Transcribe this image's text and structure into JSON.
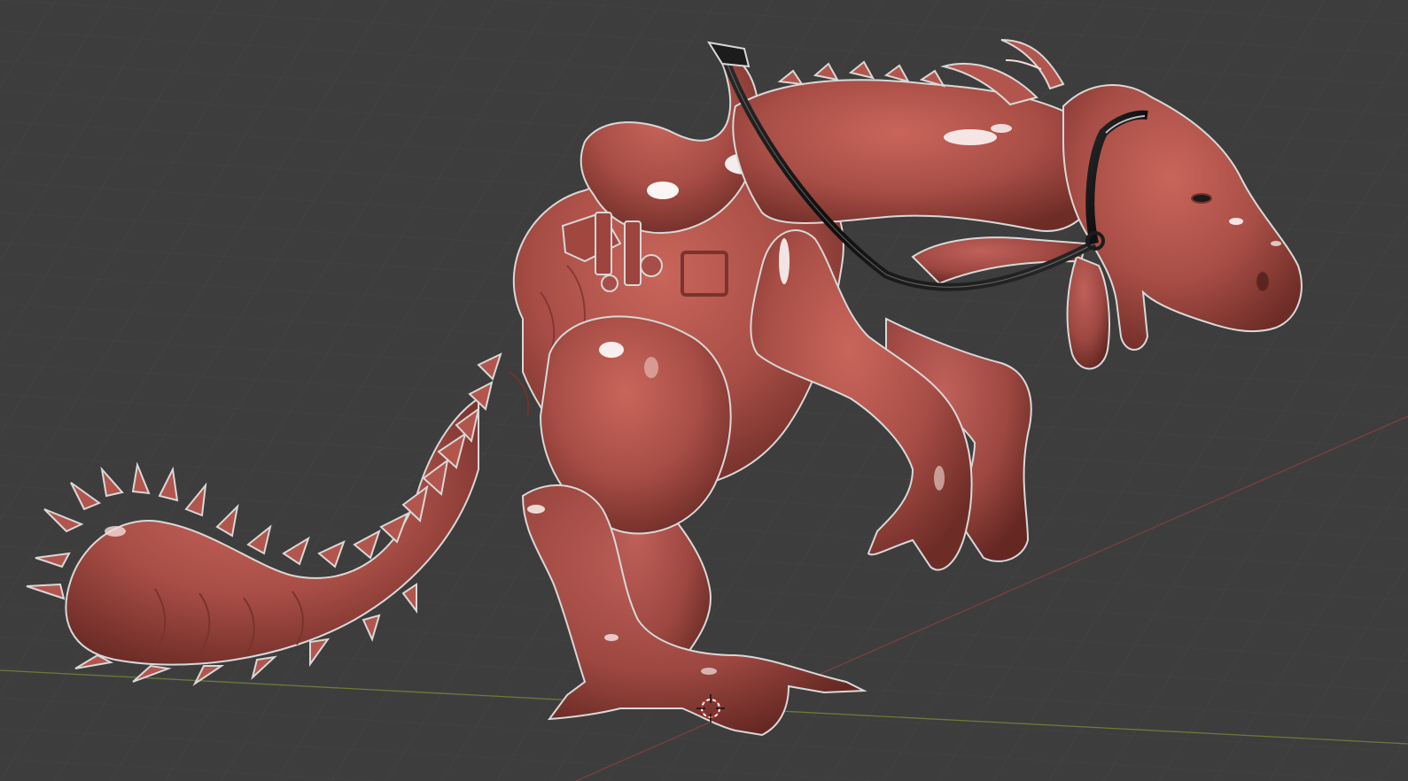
{
  "viewport": {
    "background_color": "#3d3d3d",
    "grid_color": "#4a4a4a",
    "x_axis_color": "#8a4a4a",
    "y_axis_color": "#6b7a3a"
  },
  "model": {
    "material_color": "#a84e46",
    "shadow_color": "#6e2c27",
    "highlight_color": "#f5dcd8",
    "outline_color": "#d8d8d8",
    "strap_color": "#1c1c1c"
  },
  "icons": {
    "cursor": "3d-cursor-icon"
  }
}
